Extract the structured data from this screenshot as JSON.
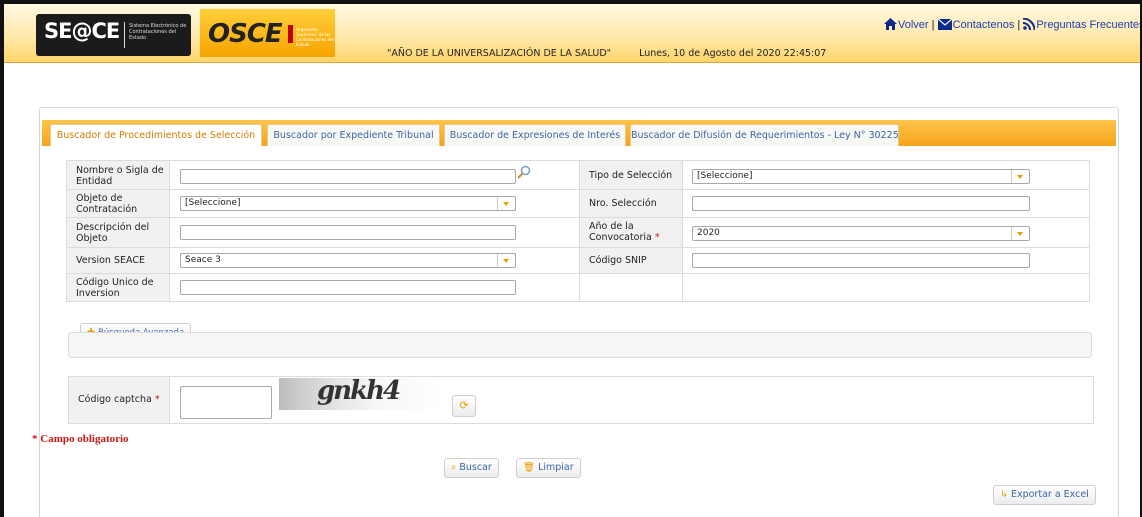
{
  "header": {
    "seace_logo": "SE@CE",
    "seace_subtitle": "Sistema Electrónico de Contrataciones del Estado",
    "osce_logo": "OSCE",
    "osce_subtitle": "Organismo Supervisor de las Contrataciones del Estado",
    "slogan": "\"AÑO DE LA UNIVERSALIZACIÓN DE LA SALUD\"",
    "datetime": "Lunes, 10 de Agosto del 2020 22:45:07",
    "nav": {
      "volver": "Volver",
      "contactenos": "Contactenos",
      "preguntas": "Preguntas Frecuentes",
      "sep": "|"
    }
  },
  "tabs": [
    {
      "label": "Buscador de Procedimientos de Selección",
      "active": true
    },
    {
      "label": "Buscador por Expediente Tribunal",
      "active": false
    },
    {
      "label": "Buscador de Expresiones de Interés",
      "active": false
    },
    {
      "label": "Buscador de Difusión de Requerimientos - Ley N° 30225",
      "active": false
    }
  ],
  "form": {
    "nombre_label": "Nombre o Sigla de Entidad",
    "nombre_value": "",
    "tipo_label": "Tipo de Selección",
    "tipo_value": "[Seleccione]",
    "objeto_label": "Objeto de Contratación",
    "objeto_value": "[Seleccione]",
    "nro_label": "Nro. Selección",
    "nro_value": "",
    "descripcion_label": "Descripción del Objeto",
    "descripcion_value": "",
    "anio_label": "Año de la Convocatoria",
    "anio_req": "*",
    "anio_value": "2020",
    "version_label": "Version SEACE",
    "version_value": "Seace 3",
    "snip_label": "Código SNIP",
    "snip_value": "",
    "cui_label": "Código Unico de Inversion",
    "cui_value": ""
  },
  "advanced": {
    "label": "Búsqueda Avanzada"
  },
  "captcha": {
    "label": "Código captcha",
    "req": "*",
    "value": "",
    "image_text": "gnkh4"
  },
  "mandatory_note": "* Campo obligatorio",
  "buttons": {
    "buscar": "Buscar",
    "limpiar": "Limpiar",
    "exportar": "Exportar a Excel"
  },
  "colors": {
    "accent_orange": "#f5a31a",
    "link_blue": "#3c66a8",
    "required_red": "#c81818"
  }
}
